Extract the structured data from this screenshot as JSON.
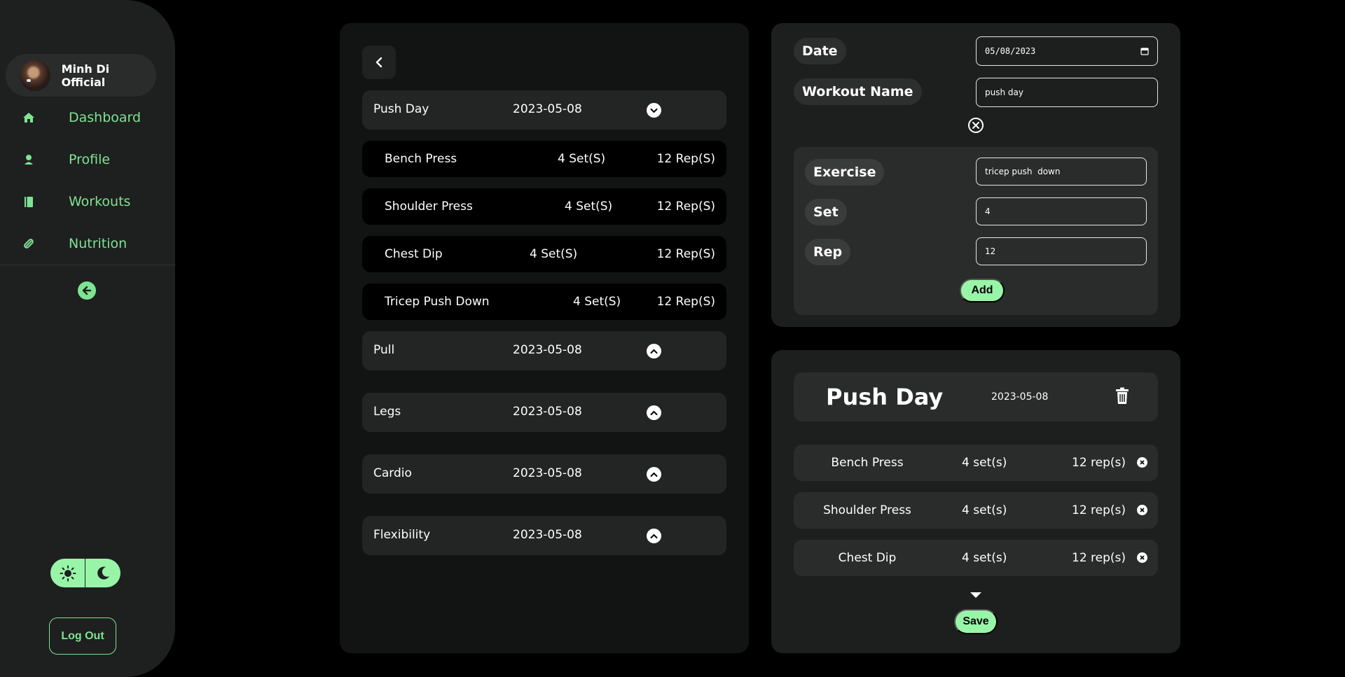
{
  "sidebar": {
    "profile_name": "Minh Di Official",
    "nav": [
      {
        "label": "Dashboard",
        "icon": "home-icon"
      },
      {
        "label": "Profile",
        "icon": "user-icon"
      },
      {
        "label": "Workouts",
        "icon": "book-icon"
      },
      {
        "label": "Nutrition",
        "icon": "pills-icon"
      }
    ],
    "logout_label": "Log Out",
    "accent": "#7ee493"
  },
  "workouts": [
    {
      "name": "Push Day",
      "date": "2023-05-08",
      "expanded": true,
      "exercises": [
        {
          "name": "Bench Press",
          "sets": "4 Set(S)",
          "reps": "12 Rep(S)"
        },
        {
          "name": "Shoulder Press",
          "sets": "4 Set(S)",
          "reps": "12 Rep(S)"
        },
        {
          "name": "Chest Dip",
          "sets": "4 Set(S)",
          "reps": "12 Rep(S)"
        },
        {
          "name": "Tricep Push Down",
          "sets": "4 Set(S)",
          "reps": "12 Rep(S)"
        }
      ]
    },
    {
      "name": "Pull",
      "date": "2023-05-08",
      "expanded": false
    },
    {
      "name": "Legs",
      "date": "2023-05-08",
      "expanded": false
    },
    {
      "name": "Cardio",
      "date": "2023-05-08",
      "expanded": false
    },
    {
      "name": "Flexibility",
      "date": "2023-05-08",
      "expanded": false
    }
  ],
  "form": {
    "date_label": "Date",
    "date_value": "05/08/2023",
    "workout_name_label": "Workout Name",
    "workout_name_value": "push day",
    "exercise_label": "Exercise",
    "exercise_value": "tricep push  down",
    "set_label": "Set",
    "set_value": "4",
    "rep_label": "Rep",
    "rep_value": "12",
    "add_label": "Add"
  },
  "preview": {
    "title": "Push Day",
    "date": "2023-05-08",
    "rows": [
      {
        "name": "Bench Press",
        "sets": "4 set(s)",
        "reps": "12 rep(s)"
      },
      {
        "name": "Shoulder Press",
        "sets": "4 set(s)",
        "reps": "12 rep(s)"
      },
      {
        "name": "Chest Dip",
        "sets": "4 set(s)",
        "reps": "12 rep(s)"
      }
    ],
    "save_label": "Save"
  }
}
